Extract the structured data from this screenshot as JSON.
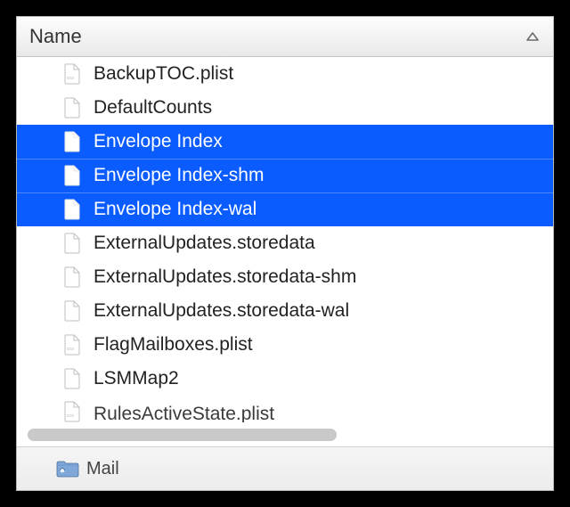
{
  "header": {
    "column_label": "Name",
    "sort_direction": "asc"
  },
  "files": [
    {
      "name": "BackupTOC.plist",
      "icon": "plist",
      "selected": false
    },
    {
      "name": "DefaultCounts",
      "icon": "generic",
      "selected": false
    },
    {
      "name": "Envelope Index",
      "icon": "generic",
      "selected": true
    },
    {
      "name": "Envelope Index-shm",
      "icon": "generic",
      "selected": true
    },
    {
      "name": "Envelope Index-wal",
      "icon": "generic",
      "selected": true
    },
    {
      "name": "ExternalUpdates.storedata",
      "icon": "generic",
      "selected": false
    },
    {
      "name": "ExternalUpdates.storedata-shm",
      "icon": "generic",
      "selected": false
    },
    {
      "name": "ExternalUpdates.storedata-wal",
      "icon": "generic",
      "selected": false
    },
    {
      "name": "FlagMailboxes.plist",
      "icon": "plist",
      "selected": false
    },
    {
      "name": "LSMMap2",
      "icon": "generic",
      "selected": false
    },
    {
      "name": "RulesActiveState.plist",
      "icon": "plist",
      "selected": false,
      "clipped": true
    }
  ],
  "footer": {
    "path_item": "Mail"
  },
  "colors": {
    "selection": "#0a5cff"
  }
}
